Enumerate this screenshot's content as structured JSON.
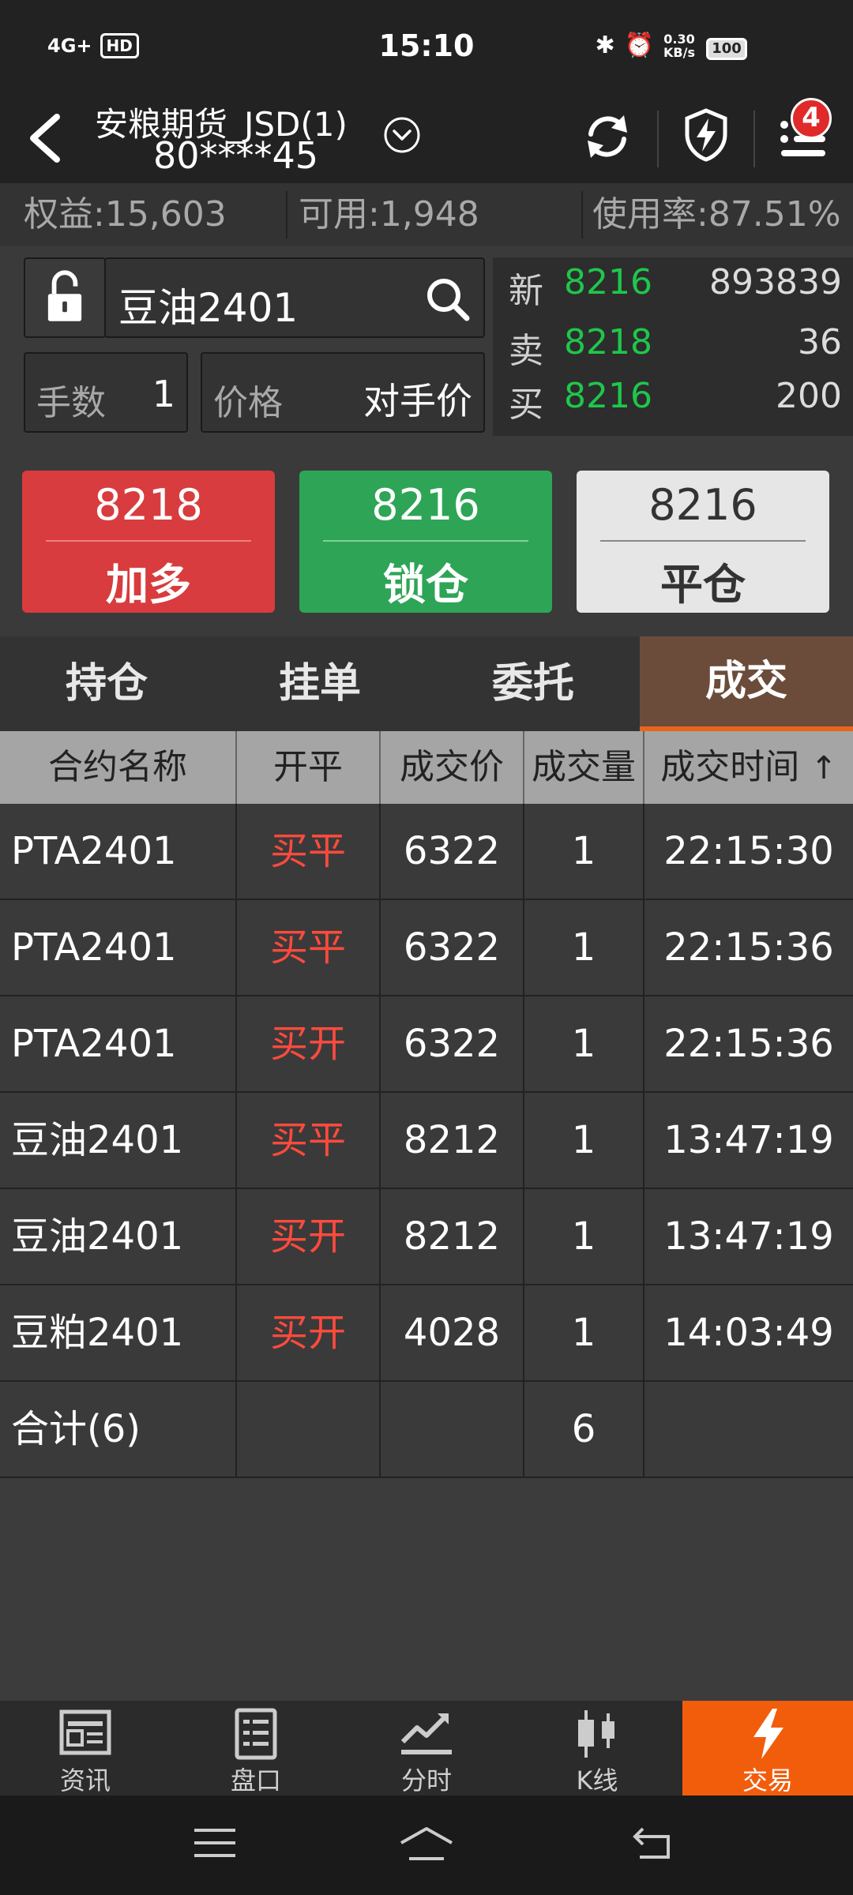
{
  "status_bar": {
    "network": "4G+",
    "hd": "HD",
    "time": "15:10",
    "speed_value": "0.30",
    "speed_unit": "KB/s",
    "battery": "100"
  },
  "header": {
    "account_name": "安粮期货_JSD(1)",
    "account_number": "80****45",
    "notification_count": "4"
  },
  "summary": {
    "equity": "权益:15,603",
    "available": "可用:1,948",
    "usage": "使用率:87.51%"
  },
  "order": {
    "contract": "豆油2401",
    "lots_label": "手数",
    "lots_value": "1",
    "price_label": "价格",
    "price_value": "对手价"
  },
  "quote": {
    "last_label": "新",
    "last_price": "8216",
    "last_volume": "893839",
    "ask_label": "卖",
    "ask_price": "8218",
    "ask_volume": "36",
    "bid_label": "买",
    "bid_price": "8216",
    "bid_volume": "200"
  },
  "buttons": {
    "long_price": "8218",
    "long_label": "加多",
    "lock_price": "8216",
    "lock_label": "锁仓",
    "close_price": "8216",
    "close_label": "平仓"
  },
  "tabs": [
    "持仓",
    "挂单",
    "委托",
    "成交"
  ],
  "table": {
    "headers": [
      "合约名称",
      "开平",
      "成交价",
      "成交量",
      "成交时间"
    ],
    "sort_arrow": "↑",
    "rows": [
      [
        "PTA2401",
        "买平",
        "6322",
        "1",
        "22:15:30"
      ],
      [
        "PTA2401",
        "买平",
        "6322",
        "1",
        "22:15:36"
      ],
      [
        "PTA2401",
        "买开",
        "6322",
        "1",
        "22:15:36"
      ],
      [
        "豆油2401",
        "买平",
        "8212",
        "1",
        "13:47:19"
      ],
      [
        "豆油2401",
        "买开",
        "8212",
        "1",
        "13:47:19"
      ],
      [
        "豆粕2401",
        "买开",
        "4028",
        "1",
        "14:03:49"
      ]
    ],
    "total": [
      "合计(6)",
      "",
      "",
      "6",
      ""
    ]
  },
  "bottom_nav": [
    "资讯",
    "盘口",
    "分时",
    "K线",
    "交易"
  ],
  "colors": {
    "up_red": "#d83c3e",
    "down_green": "#2ea556",
    "accent_orange": "#f25d0c"
  }
}
